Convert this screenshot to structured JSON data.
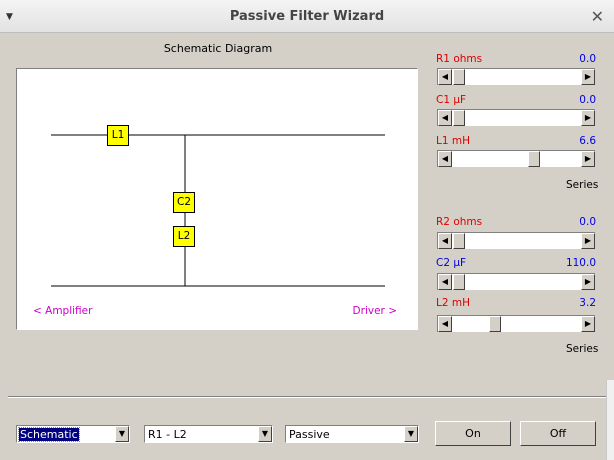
{
  "window": {
    "title": "Passive Filter Wizard",
    "menu_icon": "chevron-down-icon",
    "close_icon": "close-icon"
  },
  "diagram": {
    "label": "Schematic Diagram",
    "components": {
      "l1": "L1",
      "c2": "C2",
      "l2": "L2"
    },
    "left_port": "<  Amplifier",
    "right_port": "Driver  >"
  },
  "section1": {
    "r1": {
      "label": "R1  ohms",
      "value": "0.0",
      "level": 0.0
    },
    "c1": {
      "label": "C1  µF",
      "value": "0.0",
      "level": 0.0
    },
    "l1": {
      "label": "L1  mH",
      "value": "6.6",
      "level": 0.67
    },
    "mode": "Series"
  },
  "section2": {
    "r2": {
      "label": "R2  ohms",
      "value": "0.0",
      "level": 0.0
    },
    "c2": {
      "label": "C2  µF",
      "value": "110.0",
      "level": 0.0
    },
    "l2": {
      "label": "L2  mH",
      "value": "3.2",
      "level": 0.31
    },
    "mode": "Series"
  },
  "footer": {
    "view_select": "Schematic",
    "range_select": "R1 - L2",
    "type_select": "Passive",
    "on_button": "On",
    "off_button": "Off"
  }
}
